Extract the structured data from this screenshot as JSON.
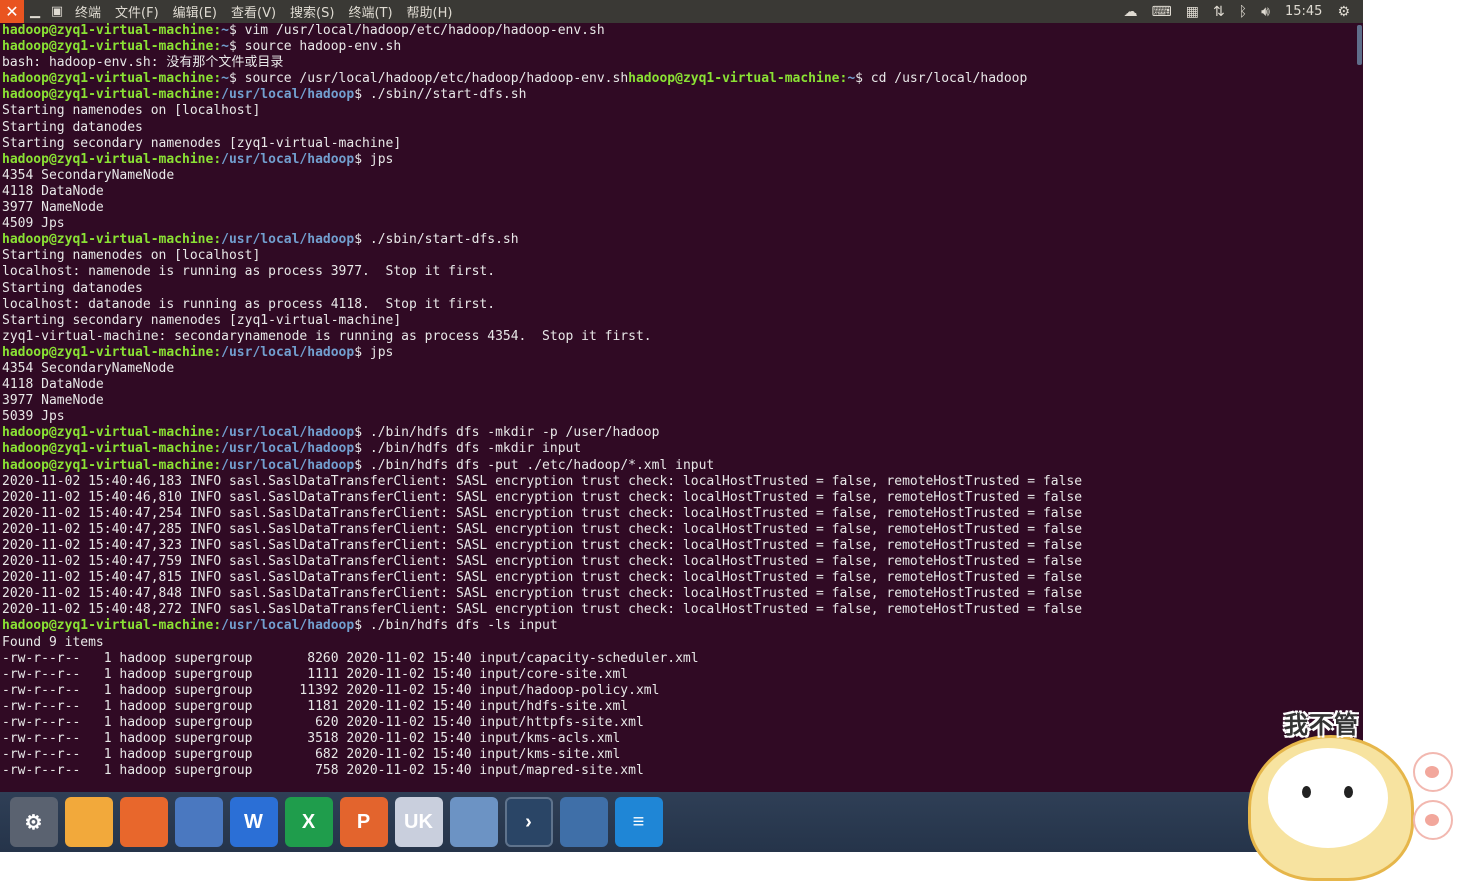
{
  "window": {
    "close_icon": "close-icon",
    "menu": [
      "终端",
      "文件(F)",
      "编辑(E)",
      "查看(V)",
      "搜索(S)",
      "终端(T)",
      "帮助(H)"
    ]
  },
  "tray": {
    "icons": [
      "weather-icon",
      "keyboard-icon",
      "calendar-icon",
      "network-icon",
      "bluetooth-icon",
      "volume-icon"
    ],
    "clock": "15:45"
  },
  "terminal": {
    "prompt_user": "hadoop@zyq1-virtual-machine",
    "lines": [
      {
        "u": "hadoop@zyq1-virtual-machine",
        "p": "~",
        "c": "$ vim /usr/local/hadoop/etc/hadoop/hadoop-env.sh"
      },
      {
        "u": "hadoop@zyq1-virtual-machine",
        "p": "~",
        "c": "$ source hadoop-env.sh"
      },
      {
        "t": "bash: hadoop-env.sh: 没有那个文件或目录"
      },
      {
        "u": "hadoop@zyq1-virtual-machine",
        "p": "~",
        "c": "$ source /usr/local/hadoop/etc/hadoop/hadoop-env.sh",
        "u2": "hadoop@zyq1-virtual-machine",
        "p2": "~",
        "c2": "$ cd /usr/local/hadoop"
      },
      {
        "u": "hadoop@zyq1-virtual-machine",
        "p": "/usr/local/hadoop",
        "c": "$ ./sbin//start-dfs.sh"
      },
      {
        "t": "Starting namenodes on [localhost]"
      },
      {
        "t": "Starting datanodes"
      },
      {
        "t": "Starting secondary namenodes [zyq1-virtual-machine]"
      },
      {
        "u": "hadoop@zyq1-virtual-machine",
        "p": "/usr/local/hadoop",
        "c": "$ jps"
      },
      {
        "t": "4354 SecondaryNameNode"
      },
      {
        "t": "4118 DataNode"
      },
      {
        "t": "3977 NameNode"
      },
      {
        "t": "4509 Jps"
      },
      {
        "u": "hadoop@zyq1-virtual-machine",
        "p": "/usr/local/hadoop",
        "c": "$ ./sbin/start-dfs.sh"
      },
      {
        "t": "Starting namenodes on [localhost]"
      },
      {
        "t": "localhost: namenode is running as process 3977.  Stop it first."
      },
      {
        "t": "Starting datanodes"
      },
      {
        "t": "localhost: datanode is running as process 4118.  Stop it first."
      },
      {
        "t": "Starting secondary namenodes [zyq1-virtual-machine]"
      },
      {
        "t": "zyq1-virtual-machine: secondarynamenode is running as process 4354.  Stop it first."
      },
      {
        "u": "hadoop@zyq1-virtual-machine",
        "p": "/usr/local/hadoop",
        "c": "$ jps"
      },
      {
        "t": "4354 SecondaryNameNode"
      },
      {
        "t": "4118 DataNode"
      },
      {
        "t": "3977 NameNode"
      },
      {
        "t": "5039 Jps"
      },
      {
        "u": "hadoop@zyq1-virtual-machine",
        "p": "/usr/local/hadoop",
        "c": "$ ./bin/hdfs dfs -mkdir -p /user/hadoop"
      },
      {
        "u": "hadoop@zyq1-virtual-machine",
        "p": "/usr/local/hadoop",
        "c": "$ ./bin/hdfs dfs -mkdir input"
      },
      {
        "u": "hadoop@zyq1-virtual-machine",
        "p": "/usr/local/hadoop",
        "c": "$ ./bin/hdfs dfs -put ./etc/hadoop/*.xml input"
      },
      {
        "t": "2020-11-02 15:40:46,183 INFO sasl.SaslDataTransferClient: SASL encryption trust check: localHostTrusted = false, remoteHostTrusted = false"
      },
      {
        "t": "2020-11-02 15:40:46,810 INFO sasl.SaslDataTransferClient: SASL encryption trust check: localHostTrusted = false, remoteHostTrusted = false"
      },
      {
        "t": "2020-11-02 15:40:47,254 INFO sasl.SaslDataTransferClient: SASL encryption trust check: localHostTrusted = false, remoteHostTrusted = false"
      },
      {
        "t": "2020-11-02 15:40:47,285 INFO sasl.SaslDataTransferClient: SASL encryption trust check: localHostTrusted = false, remoteHostTrusted = false"
      },
      {
        "t": "2020-11-02 15:40:47,323 INFO sasl.SaslDataTransferClient: SASL encryption trust check: localHostTrusted = false, remoteHostTrusted = false"
      },
      {
        "t": "2020-11-02 15:40:47,759 INFO sasl.SaslDataTransferClient: SASL encryption trust check: localHostTrusted = false, remoteHostTrusted = false"
      },
      {
        "t": "2020-11-02 15:40:47,815 INFO sasl.SaslDataTransferClient: SASL encryption trust check: localHostTrusted = false, remoteHostTrusted = false"
      },
      {
        "t": "2020-11-02 15:40:47,848 INFO sasl.SaslDataTransferClient: SASL encryption trust check: localHostTrusted = false, remoteHostTrusted = false"
      },
      {
        "t": "2020-11-02 15:40:48,272 INFO sasl.SaslDataTransferClient: SASL encryption trust check: localHostTrusted = false, remoteHostTrusted = false"
      },
      {
        "u": "hadoop@zyq1-virtual-machine",
        "p": "/usr/local/hadoop",
        "c": "$ ./bin/hdfs dfs -ls input"
      },
      {
        "t": "Found 9 items"
      },
      {
        "t": "-rw-r--r--   1 hadoop supergroup       8260 2020-11-02 15:40 input/capacity-scheduler.xml"
      },
      {
        "t": "-rw-r--r--   1 hadoop supergroup       1111 2020-11-02 15:40 input/core-site.xml"
      },
      {
        "t": "-rw-r--r--   1 hadoop supergroup      11392 2020-11-02 15:40 input/hadoop-policy.xml"
      },
      {
        "t": "-rw-r--r--   1 hadoop supergroup       1181 2020-11-02 15:40 input/hdfs-site.xml"
      },
      {
        "t": "-rw-r--r--   1 hadoop supergroup        620 2020-11-02 15:40 input/httpfs-site.xml"
      },
      {
        "t": "-rw-r--r--   1 hadoop supergroup       3518 2020-11-02 15:40 input/kms-acls.xml"
      },
      {
        "t": "-rw-r--r--   1 hadoop supergroup        682 2020-11-02 15:40 input/kms-site.xml"
      },
      {
        "t": "-rw-r--r--   1 hadoop supergroup        758 2020-11-02 15:40 input/mapred-site.xml"
      }
    ]
  },
  "dock": [
    {
      "name": "system-settings-icon",
      "glyph": "⚙",
      "bg": "#5a6270"
    },
    {
      "name": "files-icon",
      "glyph": "",
      "bg": "#f2a93b"
    },
    {
      "name": "firefox-icon",
      "glyph": "",
      "bg": "#e8672c"
    },
    {
      "name": "chromium-icon",
      "glyph": "",
      "bg": "#4a78c0"
    },
    {
      "name": "word-icon",
      "glyph": "W",
      "bg": "#2b6fd6"
    },
    {
      "name": "excel-icon",
      "glyph": "X",
      "bg": "#1f9d4c"
    },
    {
      "name": "powerpoint-icon",
      "glyph": "P",
      "bg": "#e3642d"
    },
    {
      "name": "ukylin-icon",
      "glyph": "UK",
      "bg": "#c9cfdd"
    },
    {
      "name": "network-manager-icon",
      "glyph": "",
      "bg": "#6c93c4"
    },
    {
      "name": "terminal-icon",
      "glyph": "›",
      "bg": "#2a4566"
    },
    {
      "name": "workspace-switcher-icon",
      "glyph": "",
      "bg": "#3f6fa8"
    },
    {
      "name": "dvd-icon",
      "glyph": "≡",
      "bg": "#1f86d6"
    }
  ],
  "sticker": {
    "text": "我不管"
  }
}
